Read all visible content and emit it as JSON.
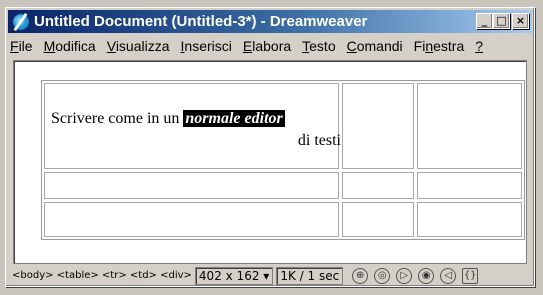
{
  "window": {
    "title": "Untitled Document (Untitled-3*) - Dreamweaver",
    "controls": {
      "minimize": "_",
      "maximize": "□",
      "close": "×"
    }
  },
  "menu": [
    {
      "label": "File",
      "accel": "F",
      "rest": "ile"
    },
    {
      "label": "Modifica",
      "accel": "M",
      "rest": "odifica"
    },
    {
      "label": "Visualizza",
      "accel": "V",
      "rest": "isualizza"
    },
    {
      "label": "Inserisci",
      "accel": "I",
      "rest": "nserisci"
    },
    {
      "label": "Elabora",
      "accel": "E",
      "rest": "labora"
    },
    {
      "label": "Testo",
      "accel": "T",
      "rest": "esto"
    },
    {
      "label": "Comandi",
      "accel": "C",
      "rest": "omandi"
    },
    {
      "label": "Finestra",
      "pre": "Fi",
      "accel": "n",
      "rest": "estra"
    },
    {
      "label": "?",
      "accel": "?",
      "rest": ""
    }
  ],
  "document": {
    "cell_text_before": "Scrivere come in un ",
    "cell_text_selected": "normale editor",
    "cell_text_after": "di testi"
  },
  "status": {
    "tags": "<body> <table> <tr> <td> <div>",
    "dimensions": "402 x 162",
    "dimensions_arrow": "▾",
    "download": "1K / 1 sec",
    "icons": [
      "site-icon",
      "assets-icon",
      "html-styles-icon",
      "css-styles-icon",
      "behaviors-icon",
      "history-icon",
      "code-inspector-icon"
    ]
  }
}
